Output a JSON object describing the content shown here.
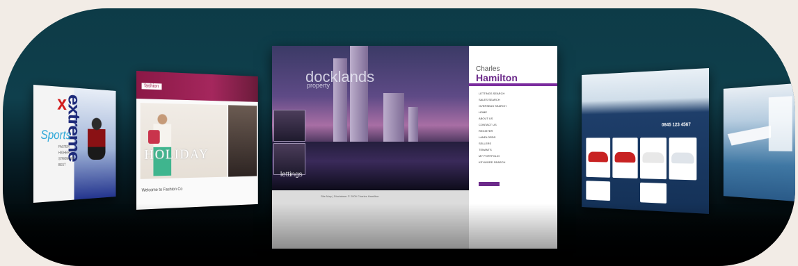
{
  "scene": {
    "description_role": "showcase-banner",
    "background_color": "#f2ece6",
    "frame_gradient": [
      "#0d3b47",
      "#061d26",
      "#000000"
    ]
  },
  "card_sports": {
    "title": "extreme",
    "letter": "x",
    "wordmark": "Sports",
    "menu": [
      "FASTER",
      "HIGHER",
      "STRONGER",
      "BEST"
    ],
    "accent": "#2aa6d8"
  },
  "card_fashion": {
    "logo": "fashion",
    "hero_text": "HOLIDAY",
    "welcome": "Welcome to Fashion Co",
    "accent": "#a5275d"
  },
  "card_docklands": {
    "headline": "docklands",
    "subheadline": "property",
    "lettings": "lettings",
    "brand_line1": "Charles",
    "brand_line2": "Hamilton",
    "nav_items": [
      "Lettings Search",
      "Sales Search",
      "Overseas Search",
      "Home",
      "About Us",
      "Contact Us",
      "Register",
      "Landlords",
      "Sellers",
      "Tenants",
      "My Portfolio",
      "Keyword Search"
    ],
    "footer": "Site Map | Disclaimer  © 2009 Charles Hamilton",
    "accent": "#6c2a8a"
  },
  "card_cars": {
    "phone": "0845 123 4567",
    "accent": "#143157"
  },
  "card_ship": {
    "accent": "#3f77a3"
  }
}
